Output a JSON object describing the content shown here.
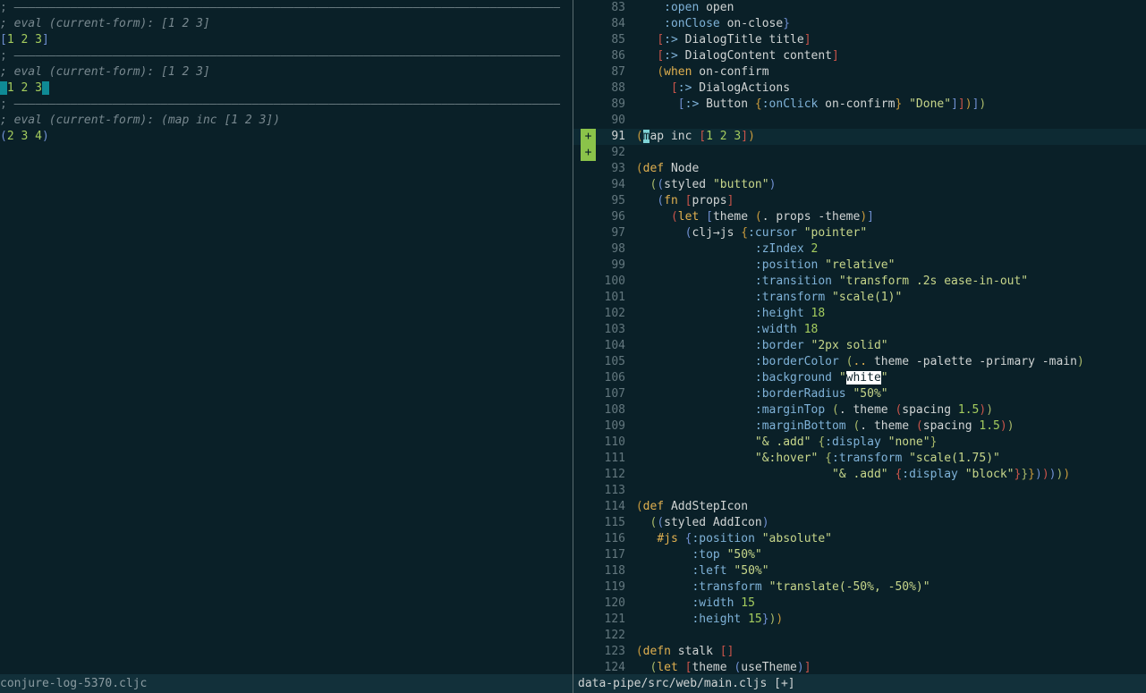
{
  "left_pane": {
    "lines": [
      {
        "kind": "sep",
        "text": "; ——————————————————————————————————————————————————————————————————————————————"
      },
      {
        "kind": "comment",
        "text": "; eval (current-form): [1 2 3]"
      },
      {
        "kind": "result",
        "text": "[1 2 3]"
      },
      {
        "kind": "sep",
        "text": "; ——————————————————————————————————————————————————————————————————————————————"
      },
      {
        "kind": "comment",
        "text": "; eval (current-form): [1 2 3]"
      },
      {
        "kind": "result-cursor",
        "text": "1 2 3"
      },
      {
        "kind": "sep",
        "text": "; ——————————————————————————————————————————————————————————————————————————————"
      },
      {
        "kind": "comment",
        "text": "; eval (current-form): (map inc [1 2 3])"
      },
      {
        "kind": "result",
        "text": "(2 3 4)"
      }
    ]
  },
  "status_left": "conjure-log-5370.cljc",
  "status_right": "data-pipe/src/web/main.cljs [+]",
  "right_pane": {
    "lines": [
      {
        "n": "83",
        "sign": "",
        "html": "    <span class=\"key\">:open</span> open"
      },
      {
        "n": "84",
        "sign": "",
        "html": "    <span class=\"key\">:onClose</span> on-close<span class=\"p4\">}</span>"
      },
      {
        "n": "85",
        "sign": "",
        "html": "   <span class=\"p3\">[</span><span class=\"key\">:&gt;</span> DialogTitle title<span class=\"p3\">]</span>"
      },
      {
        "n": "86",
        "sign": "",
        "html": "   <span class=\"p3\">[</span><span class=\"key\">:&gt;</span> DialogContent content<span class=\"p3\">]</span>"
      },
      {
        "n": "87",
        "sign": "",
        "html": "   <span class=\"p1\">(</span><span class=\"kw\">when</span> on-confirm"
      },
      {
        "n": "88",
        "sign": "",
        "html": "     <span class=\"p3\">[</span><span class=\"key\">:&gt;</span> DialogActions"
      },
      {
        "n": "89",
        "sign": "",
        "html": "      <span class=\"p4\">[</span><span class=\"key\">:&gt;</span> Button <span class=\"p1\">{</span><span class=\"key\">:onClick</span> on-confirm<span class=\"p1\">}</span> <span class=\"str\">\"Done\"</span><span class=\"p4\">]</span><span class=\"p3\">]</span><span class=\"p1\">)</span><span class=\"p4\">]</span><span class=\"p2\">)</span>"
      },
      {
        "n": "90",
        "sign": "",
        "html": ""
      },
      {
        "n": "91",
        "sign": "+",
        "current": true,
        "html": "<span class=\"p1\">(</span><span class=\"cur-light\">m</span>ap inc <span class=\"p3\">[</span><span class=\"num\">1 2 3</span><span class=\"p3\">]</span><span class=\"p1\">)</span>"
      },
      {
        "n": "92",
        "sign": "+",
        "html": ""
      },
      {
        "n": "93",
        "sign": "",
        "html": "<span class=\"p1\">(</span><span class=\"kw\">def</span> Node"
      },
      {
        "n": "94",
        "sign": "",
        "html": "  <span class=\"p2\">(</span><span class=\"p4\">(</span>styled <span class=\"str\">\"button\"</span><span class=\"p4\">)</span>"
      },
      {
        "n": "95",
        "sign": "",
        "html": "   <span class=\"p4\">(</span><span class=\"kw\">fn</span> <span class=\"p3\">[</span>props<span class=\"p3\">]</span>"
      },
      {
        "n": "96",
        "sign": "",
        "html": "     <span class=\"p3\">(</span><span class=\"kw\">let</span> <span class=\"p4\">[</span>theme <span class=\"p1\">(</span>. props -theme<span class=\"p1\">)</span><span class=\"p4\">]</span>"
      },
      {
        "n": "97",
        "sign": "",
        "html": "       <span class=\"p4\">(</span>clj→js <span class=\"p1\">{</span><span class=\"key\">:cursor</span> <span class=\"str\">\"pointer\"</span>"
      },
      {
        "n": "98",
        "sign": "",
        "html": "                 <span class=\"key\">:zIndex</span> <span class=\"num\">2</span>"
      },
      {
        "n": "99",
        "sign": "",
        "html": "                 <span class=\"key\">:position</span> <span class=\"str\">\"relative\"</span>"
      },
      {
        "n": "100",
        "sign": "",
        "html": "                 <span class=\"key\">:transition</span> <span class=\"str\">\"transform .2s ease-in-out\"</span>"
      },
      {
        "n": "101",
        "sign": "",
        "html": "                 <span class=\"key\">:transform</span> <span class=\"str\">\"scale(1)\"</span>"
      },
      {
        "n": "102",
        "sign": "",
        "html": "                 <span class=\"key\">:height</span> <span class=\"num\">18</span>"
      },
      {
        "n": "103",
        "sign": "",
        "html": "                 <span class=\"key\">:width</span> <span class=\"num\">18</span>"
      },
      {
        "n": "104",
        "sign": "",
        "html": "                 <span class=\"key\">:border</span> <span class=\"str\">\"2px solid\"</span>"
      },
      {
        "n": "105",
        "sign": "",
        "html": "                 <span class=\"key\">:borderColor</span> <span class=\"p2\">(</span><span class=\"kw\">..</span> theme -palette -primary -main<span class=\"p2\">)</span>"
      },
      {
        "n": "106",
        "sign": "",
        "html": "                 <span class=\"key\">:background</span> <span class=\"str\">\"</span><span class=\"hl-white\">white</span><span class=\"str\">\"</span>"
      },
      {
        "n": "107",
        "sign": "",
        "html": "                 <span class=\"key\">:borderRadius</span> <span class=\"str\">\"50%\"</span>"
      },
      {
        "n": "108",
        "sign": "",
        "html": "                 <span class=\"key\">:marginTop</span> <span class=\"p2\">(</span>. theme <span class=\"p3\">(</span>spacing <span class=\"num\">1.5</span><span class=\"p3\">)</span><span class=\"p2\">)</span>"
      },
      {
        "n": "109",
        "sign": "",
        "html": "                 <span class=\"key\">:marginBottom</span> <span class=\"p2\">(</span>. theme <span class=\"p3\">(</span>spacing <span class=\"num\">1.5</span><span class=\"p3\">)</span><span class=\"p2\">)</span>"
      },
      {
        "n": "110",
        "sign": "",
        "html": "                 <span class=\"str\">\"&amp; .add\"</span> <span class=\"p2\">{</span><span class=\"key\">:display</span> <span class=\"str\">\"none\"</span><span class=\"p2\">}</span>"
      },
      {
        "n": "111",
        "sign": "",
        "html": "                 <span class=\"str\">\"&amp;:hover\"</span> <span class=\"p2\">{</span><span class=\"key\">:transform</span> <span class=\"str\">\"scale(1.75)\"</span>"
      },
      {
        "n": "112",
        "sign": "",
        "html": "                            <span class=\"str\">\"&amp; .add\"</span> <span class=\"p3\">{</span><span class=\"key\">:display</span> <span class=\"str\">\"block\"</span><span class=\"p3\">}</span><span class=\"p2\">}</span><span class=\"p1\">}</span><span class=\"p4\">)</span><span class=\"p3\">)</span><span class=\"p4\">)</span><span class=\"p2\">)</span><span class=\"p1\">)</span>"
      },
      {
        "n": "113",
        "sign": "",
        "html": ""
      },
      {
        "n": "114",
        "sign": "",
        "html": "<span class=\"p1\">(</span><span class=\"kw\">def</span> AddStepIcon"
      },
      {
        "n": "115",
        "sign": "",
        "html": "  <span class=\"p2\">(</span><span class=\"p4\">(</span>styled AddIcon<span class=\"p4\">)</span>"
      },
      {
        "n": "116",
        "sign": "",
        "html": "   <span class=\"kw\">#js</span> <span class=\"p4\">{</span><span class=\"key\">:position</span> <span class=\"str\">\"absolute\"</span>"
      },
      {
        "n": "117",
        "sign": "",
        "html": "        <span class=\"key\">:top</span> <span class=\"str\">\"50%\"</span>"
      },
      {
        "n": "118",
        "sign": "",
        "html": "        <span class=\"key\">:left</span> <span class=\"str\">\"50%\"</span>"
      },
      {
        "n": "119",
        "sign": "",
        "html": "        <span class=\"key\">:transform</span> <span class=\"str\">\"translate(-50%, -50%)\"</span>"
      },
      {
        "n": "120",
        "sign": "",
        "html": "        <span class=\"key\">:width</span> <span class=\"num\">15</span>"
      },
      {
        "n": "121",
        "sign": "",
        "html": "        <span class=\"key\">:height</span> <span class=\"num\">15</span><span class=\"p4\">}</span><span class=\"p2\">)</span><span class=\"p1\">)</span>"
      },
      {
        "n": "122",
        "sign": "",
        "html": ""
      },
      {
        "n": "123",
        "sign": "",
        "html": "<span class=\"p1\">(</span><span class=\"kw\">defn</span> stalk <span class=\"p3\">[]</span>"
      },
      {
        "n": "124",
        "sign": "",
        "html": "  <span class=\"p2\">(</span><span class=\"kw\">let</span> <span class=\"p3\">[</span>theme <span class=\"p4\">(</span>useTheme<span class=\"p4\">)</span><span class=\"p3\">]</span>"
      }
    ]
  }
}
